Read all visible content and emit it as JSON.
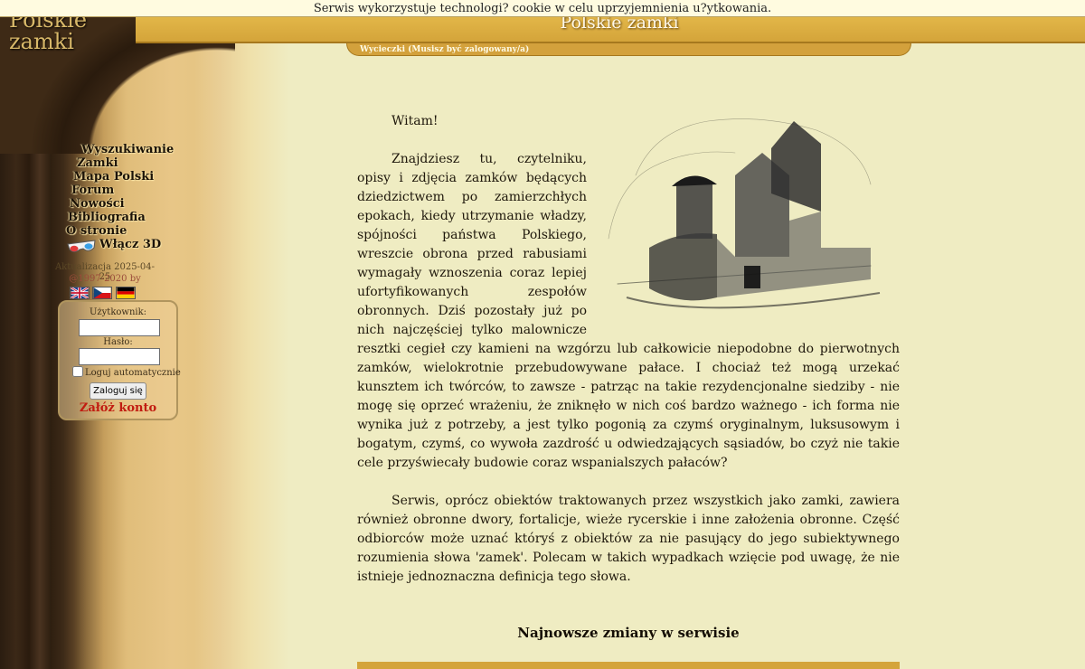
{
  "cookie_notice": "Serwis wykorzystuje technologi? cookie w celu uprzyjemnienia u?ytkowania.",
  "site": {
    "logo_line1": "Polskie",
    "logo_line2": "zamki",
    "heading": "Polskie zamki"
  },
  "submenu": {
    "trips_link": "Wycieczki (Musisz być zalogowany/a)"
  },
  "nav": {
    "items": [
      "Wyszukiwanie",
      "Zamki",
      "Mapa Polski",
      "Forum",
      "Nowości",
      "Bibliografia",
      "O stronie"
    ],
    "toggle_3d": "Włącz 3D",
    "toggle_3d_icon": "3d-glasses-icon"
  },
  "footer_info": {
    "updated": "Aktualizacja 2025-04-25",
    "copyright": "@1997-2020 by"
  },
  "languages": [
    {
      "code": "en",
      "icon": "uk-flag-icon"
    },
    {
      "code": "cs",
      "icon": "czech-flag-icon"
    },
    {
      "code": "de",
      "icon": "german-flag-icon"
    }
  ],
  "login": {
    "user_label": "Użytkownik:",
    "user_value": "",
    "password_label": "Hasło:",
    "password_value": "",
    "auto_login_label": "Loguj automatycznie",
    "auto_login_checked": false,
    "submit_label": "Zaloguj się",
    "register_label": "Załóż konto"
  },
  "content": {
    "greeting": "Witam!",
    "paragraph1": "Znajdziesz tu, czytelniku, opisy i zdjęcia zamków będących dziedzictwem po zamierzchłych epokach, kiedy utrzymanie władzy, spójności państwa Polskiego, wreszcie obrona przed rabusiami wymagały wznoszenia coraz lepiej ufortyfikowanych zespołów obronnych. Dziś pozostały już po nich najczęściej tylko malownicze resztki cegieł czy kamieni na wzgórzu lub całkowicie niepodobne do pierwotnych zamków, wielokrotnie przebudowywane pałace. I chociaż też mogą urzekać kunsztem ich twórców, to zawsze - patrząc na takie rezydencjonalne siedziby - nie mogę się oprzeć wrażeniu, że zniknęło w nich coś bardzo ważnego - ich forma nie wynika już z potrzeby, a jest tylko pogonią za czymś oryginalnym, luksusowym i bogatym, czymś, co wywoła zazdrość u odwiedzających sąsiadów, bo czyż nie takie cele przyświecały budowie coraz wspanialszych pałaców?",
    "paragraph2": "Serwis, oprócz obiektów traktowanych przez wszystkich jako zamki, zawiera również obronne dwory, fortalicje, wieże rycerskie i inne założenia obronne. Część odbiorców może uznać któryś z obiektów za nie pasujący do jego subiektywnego rozumienia słowa 'zamek'. Polecam w takich wypadkach wzięcie pod uwagę, że nie istnieje jednoznaczna definicja tego słowa.",
    "latest_heading": "Najnowsze zmiany w serwisie"
  }
}
